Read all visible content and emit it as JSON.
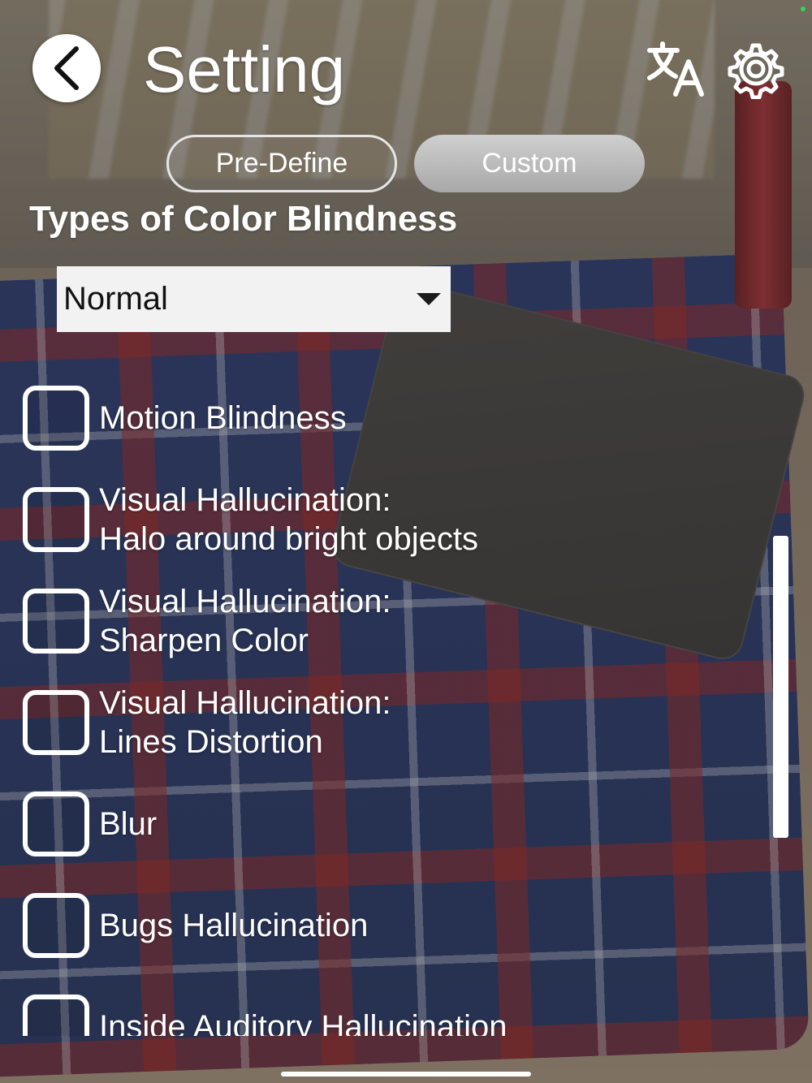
{
  "header": {
    "title": "Setting",
    "back_icon": "chevron-left-icon",
    "translate_icon": "translate-icon",
    "settings_icon": "gear-icon"
  },
  "mode_toggle": {
    "options": [
      "Pre-Define",
      "Custom"
    ],
    "selected": "Custom"
  },
  "color_blindness": {
    "heading": "Types of Color Blindness",
    "selected": "Normal"
  },
  "effects": [
    {
      "lines": [
        "Motion Blindness"
      ],
      "checked": false
    },
    {
      "lines": [
        "Visual Hallucination:",
        "Halo around bright objects"
      ],
      "checked": false
    },
    {
      "lines": [
        "Visual Hallucination:",
        "Sharpen Color"
      ],
      "checked": false
    },
    {
      "lines": [
        "Visual Hallucination:",
        "Lines Distortion"
      ],
      "checked": false
    },
    {
      "lines": [
        "Blur"
      ],
      "checked": false
    },
    {
      "lines": [
        "Bugs Hallucination"
      ],
      "checked": false
    },
    {
      "lines": [
        "Inside Auditory Hallucination"
      ],
      "checked": false
    }
  ],
  "colors": {
    "dropdown_bg": "#f2f2f2",
    "segment_selected": "#bdbdbd",
    "text": "#ffffff"
  }
}
